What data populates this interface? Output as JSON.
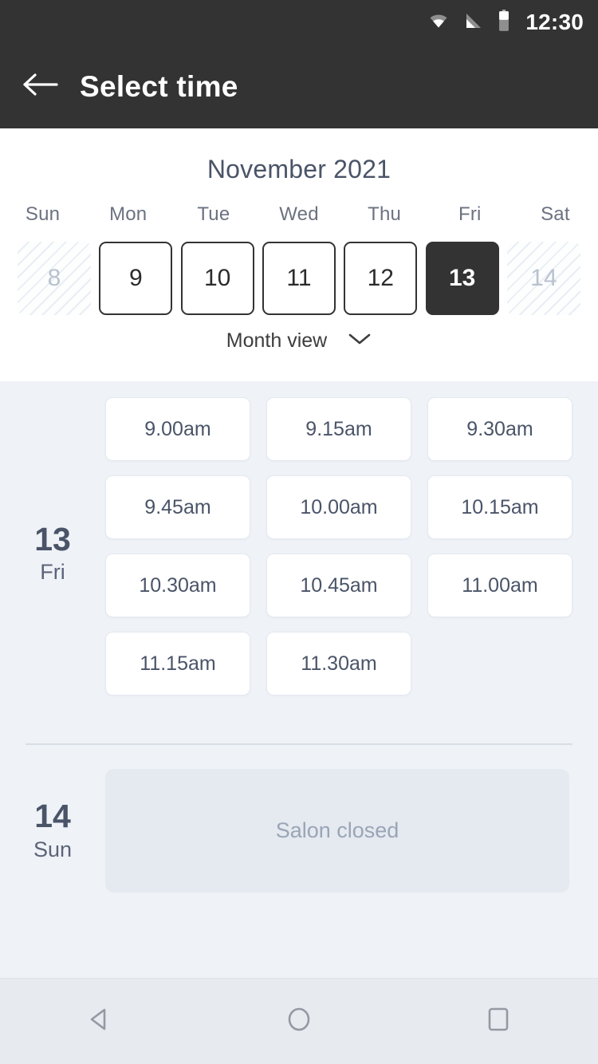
{
  "statusbar": {
    "time": "12:30",
    "icons": [
      "wifi-icon",
      "cellular-signal-icon",
      "battery-icon"
    ]
  },
  "appbar": {
    "back_icon": "back-arrow-icon",
    "title": "Select time"
  },
  "calendar": {
    "month_label": "November 2021",
    "weekdays": [
      "Sun",
      "Mon",
      "Tue",
      "Wed",
      "Thu",
      "Fri",
      "Sat"
    ],
    "days": [
      {
        "number": "8",
        "state": "disabled"
      },
      {
        "number": "9",
        "state": "available"
      },
      {
        "number": "10",
        "state": "available"
      },
      {
        "number": "11",
        "state": "available"
      },
      {
        "number": "12",
        "state": "available"
      },
      {
        "number": "13",
        "state": "selected"
      },
      {
        "number": "14",
        "state": "disabled"
      }
    ],
    "view_toggle": {
      "label": "Month view",
      "icon": "chevron-down-icon"
    }
  },
  "schedule": [
    {
      "day_number": "13",
      "day_name": "Fri",
      "slots": [
        "9.00am",
        "9.15am",
        "9.30am",
        "9.45am",
        "10.00am",
        "10.15am",
        "10.30am",
        "10.45am",
        "11.00am",
        "11.15am",
        "11.30am"
      ]
    },
    {
      "day_number": "14",
      "day_name": "Sun",
      "closed_message": "Salon closed"
    }
  ],
  "navbar": {
    "back": "nav-back-icon",
    "home": "nav-home-icon",
    "recents": "nav-recents-icon"
  },
  "colors": {
    "appbar_bg": "#333333",
    "body_bg": "#eff2f7",
    "panel_bg": "#ffffff",
    "selected_day_bg": "#333333",
    "text_primary": "#4a5468",
    "text_muted": "#9aa5b6",
    "navbar_bg": "#e7eaef"
  }
}
